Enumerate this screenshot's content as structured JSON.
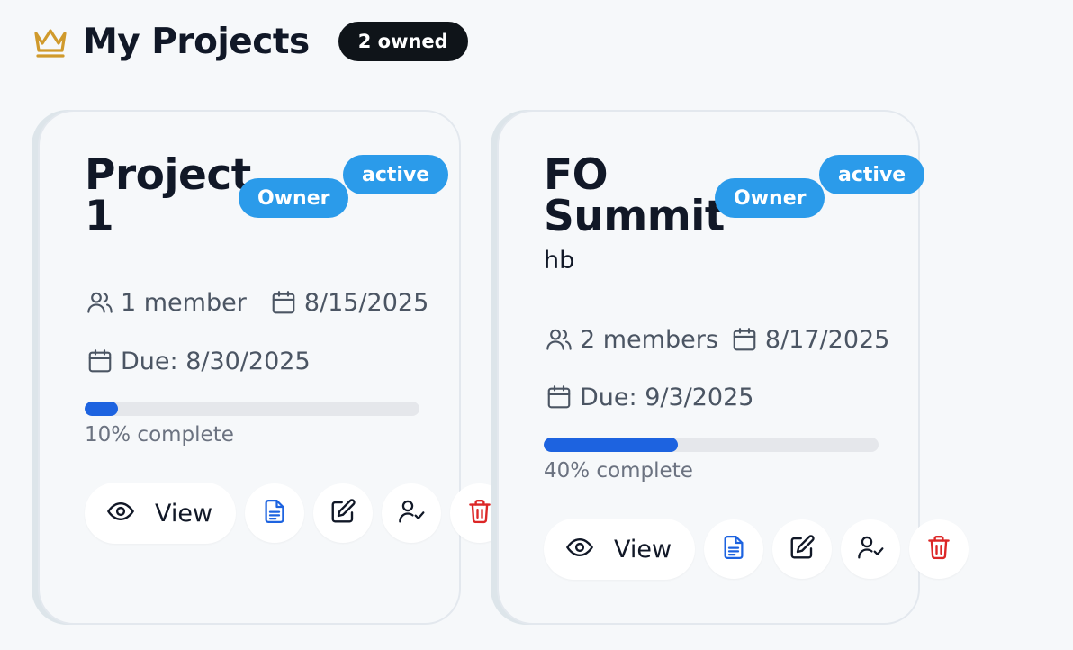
{
  "header": {
    "title": "My Projects",
    "owned_badge": "2 owned"
  },
  "colors": {
    "crown": "#d09a2c",
    "pill": "#2b9bea",
    "progress": "#1d63e0",
    "document_icon": "#1d63e0",
    "delete_icon": "#dc2626",
    "owned_badge_bg": "#0f1419"
  },
  "projects": [
    {
      "title_line1": "Project",
      "title_line2": "1",
      "subtitle": "",
      "role_label": "Owner",
      "status_label": "active",
      "members_label": "1 member",
      "created_date": "8/15/2025",
      "due_label": "Due: 8/30/2025",
      "progress": 10,
      "progress_label": "10% complete",
      "view_label": "View"
    },
    {
      "title_line1": "FO",
      "title_line2": "Summit",
      "subtitle": "hb",
      "role_label": "Owner",
      "status_label": "active",
      "members_label": "2 members",
      "created_date": "8/17/2025",
      "due_label": "Due: 9/3/2025",
      "progress": 40,
      "progress_label": "40% complete",
      "view_label": "View"
    }
  ]
}
